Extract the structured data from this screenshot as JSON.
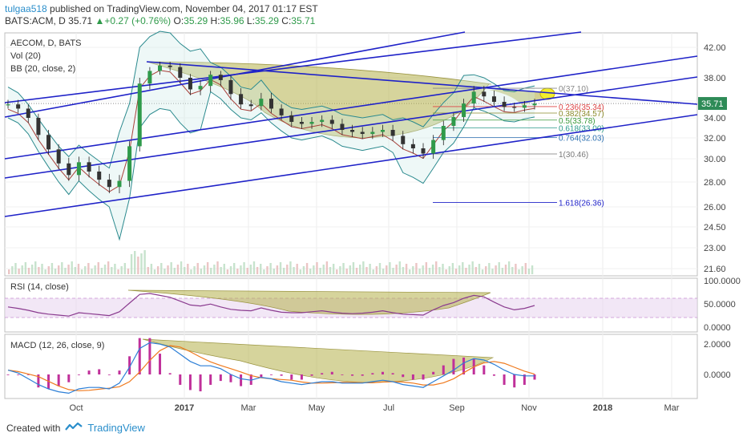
{
  "header": {
    "author": "tulgaa518",
    "published_text": " published on TradingView.com, November 04, 2017 01:17 EST",
    "symbol": "BATS:ACM, D",
    "price": "35.71",
    "change": "+0.27 (+0.76%)",
    "o_label": "O:",
    "o_value": "35.29",
    "h_label": "H:",
    "h_value": "35.96",
    "l_label": "L:",
    "l_value": "35.29",
    "c_label": "C:",
    "c_value": "35.71"
  },
  "legend": {
    "title": "AECOM, D, BATS",
    "vol": "Vol (20)",
    "bb": "BB (20, close, 2)",
    "rsi": "RSI (14, close)",
    "macd": "MACD (12, 26, close, 9)"
  },
  "footer": {
    "created_with": "Created with",
    "brand": "TradingView"
  },
  "colors": {
    "up": "#2f9a4a",
    "down": "#333333",
    "channel": "#1f22c8",
    "bb": "#2b8a8e",
    "pattern_fill": "#b5b04a",
    "rsi": "#8a3b8f",
    "macd": "#2d7fd6",
    "signal": "#ef7a1e",
    "hist": "#c0309a",
    "price_tag": "#2e8b57"
  },
  "chart_data": [
    {
      "type": "candlestick",
      "title": "AECOM, D, BATS",
      "x_ticks": [
        "Oct",
        "2017",
        "Mar",
        "May",
        "Jul",
        "Sep",
        "Nov",
        "2018",
        "Mar"
      ],
      "y_ticks": [
        "42.00",
        "38.00",
        "36.00",
        "34.00",
        "32.00",
        "30.00",
        "28.00",
        "26.00",
        "24.50",
        "23.00",
        "21.60"
      ],
      "last_price": "35.71",
      "close_series": [
        35.6,
        35.1,
        34.0,
        32.3,
        30.9,
        29.6,
        28.6,
        29.7,
        28.9,
        28.2,
        27.6,
        28.1,
        31.2,
        37.5,
        38.9,
        39.6,
        39.4,
        38.0,
        37.0,
        37.3,
        38.4,
        37.8,
        36.6,
        35.6,
        35.4,
        36.2,
        35.1,
        34.3,
        33.6,
        33.4,
        33.6,
        33.8,
        33.4,
        32.8,
        32.6,
        32.4,
        32.6,
        32.8,
        32.2,
        31.4,
        31.0,
        30.5,
        31.8,
        33.2,
        34.1,
        35.7,
        36.8,
        36.4,
        35.9,
        35.3,
        35.2,
        35.5,
        35.7
      ],
      "fibonacci": [
        {
          "level": "0(37.10)"
        },
        {
          "level": "0.236(35.34)"
        },
        {
          "level": "0.382(34.57)"
        },
        {
          "level": "0.5(33.78)"
        },
        {
          "level": "0.618(33.00)"
        },
        {
          "level": "0.764(32.03)"
        },
        {
          "level": "1(30.46)"
        },
        {
          "level": "1.618(26.36)"
        }
      ]
    },
    {
      "type": "line",
      "title": "RSI (14, close)",
      "y_ticks": [
        "100.0000",
        "50.0000",
        "0.0000"
      ],
      "series": [
        {
          "name": "RSI",
          "values": [
            52,
            49,
            45,
            40,
            37,
            35,
            33,
            40,
            38,
            36,
            34,
            42,
            60,
            78,
            80,
            76,
            72,
            64,
            56,
            54,
            58,
            52,
            47,
            45,
            44,
            50,
            45,
            41,
            40,
            40,
            42,
            44,
            41,
            39,
            38,
            39,
            41,
            44,
            40,
            37,
            36,
            35,
            46,
            55,
            61,
            70,
            76,
            73,
            62,
            52,
            46,
            49,
            55
          ]
        }
      ]
    },
    {
      "type": "line",
      "title": "MACD (12, 26, close, 9)",
      "y_ticks": [
        "2.0000",
        "0.0000"
      ],
      "series": [
        {
          "name": "MACD",
          "values": [
            0.3,
            0.1,
            -0.3,
            -0.7,
            -1.0,
            -1.2,
            -1.3,
            -1.0,
            -0.9,
            -0.9,
            -1.0,
            -0.6,
            0.5,
            1.8,
            2.2,
            2.1,
            1.9,
            1.4,
            0.9,
            0.6,
            0.6,
            0.4,
            0.0,
            -0.3,
            -0.4,
            -0.2,
            -0.3,
            -0.5,
            -0.6,
            -0.7,
            -0.6,
            -0.5,
            -0.5,
            -0.6,
            -0.6,
            -0.6,
            -0.5,
            -0.4,
            -0.5,
            -0.7,
            -0.8,
            -0.9,
            -0.5,
            -0.1,
            0.3,
            0.8,
            1.1,
            1.0,
            0.7,
            0.3,
            0.0,
            -0.1,
            -0.1
          ]
        }
      ]
    }
  ]
}
